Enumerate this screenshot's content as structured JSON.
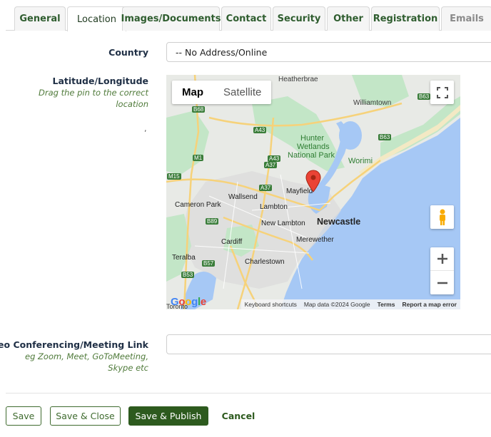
{
  "tabs": [
    {
      "label": "General"
    },
    {
      "label": "Location",
      "active": true
    },
    {
      "label": "Images/Documents"
    },
    {
      "label": "Contact"
    },
    {
      "label": "Security"
    },
    {
      "label": "Other"
    },
    {
      "label": "Registration"
    },
    {
      "label": "Emails"
    }
  ],
  "country": {
    "label": "Country",
    "value": "-- No Address/Online"
  },
  "latlng": {
    "label": "Latitude/Longitude",
    "hint_line1": "Drag the pin to the correct",
    "hint_line2": "location",
    "value": ","
  },
  "map": {
    "type_map": "Map",
    "type_satellite": "Satellite",
    "logo": "Google",
    "logo_colors": [
      "#4285F4",
      "#EA4335",
      "#FBBC05",
      "#4285F4",
      "#34A853",
      "#EA4335"
    ],
    "attribution": {
      "shortcuts": "Keyboard shortcuts",
      "data": "Map data ©2024 Google",
      "terms": "Terms",
      "report": "Report a map error"
    },
    "places": [
      {
        "name": "Heatherbrae",
        "kind": "town"
      },
      {
        "name": "Williamtown",
        "kind": "town"
      },
      {
        "name": "Hunter",
        "kind": "park"
      },
      {
        "name": "Wetlands",
        "kind": "park"
      },
      {
        "name": "National Park",
        "kind": "park"
      },
      {
        "name": "Worimi",
        "kind": "park"
      },
      {
        "name": "Mayfield",
        "kind": "town"
      },
      {
        "name": "Wallsend",
        "kind": "town"
      },
      {
        "name": "Cameron Park",
        "kind": "town"
      },
      {
        "name": "Lambton",
        "kind": "town"
      },
      {
        "name": "New Lambton",
        "kind": "town"
      },
      {
        "name": "Newcastle",
        "kind": "city"
      },
      {
        "name": "Cardiff",
        "kind": "town"
      },
      {
        "name": "Merewether",
        "kind": "town"
      },
      {
        "name": "Charlestown",
        "kind": "town"
      },
      {
        "name": "Teralba",
        "kind": "town"
      },
      {
        "name": "Toronto",
        "kind": "town"
      }
    ],
    "roads": [
      "B68",
      "A43",
      "M1",
      "A43",
      "A37",
      "M15",
      "A37",
      "B89",
      "B57",
      "B53",
      "B63",
      "B63"
    ],
    "colors": {
      "water": "#a6c8f5",
      "land": "#e8eae6",
      "park": "#c3e6c7",
      "road": "#f6d27a",
      "pin": "#ea4335"
    }
  },
  "video": {
    "label": "Video Conferencing/Meeting Link",
    "hint_line1": "eg Zoom, Meet, GoToMeeting,",
    "hint_line2": "Skype etc",
    "value": ""
  },
  "footer": {
    "save": "Save",
    "save_close": "Save & Close",
    "save_publish": "Save & Publish",
    "cancel": "Cancel"
  }
}
